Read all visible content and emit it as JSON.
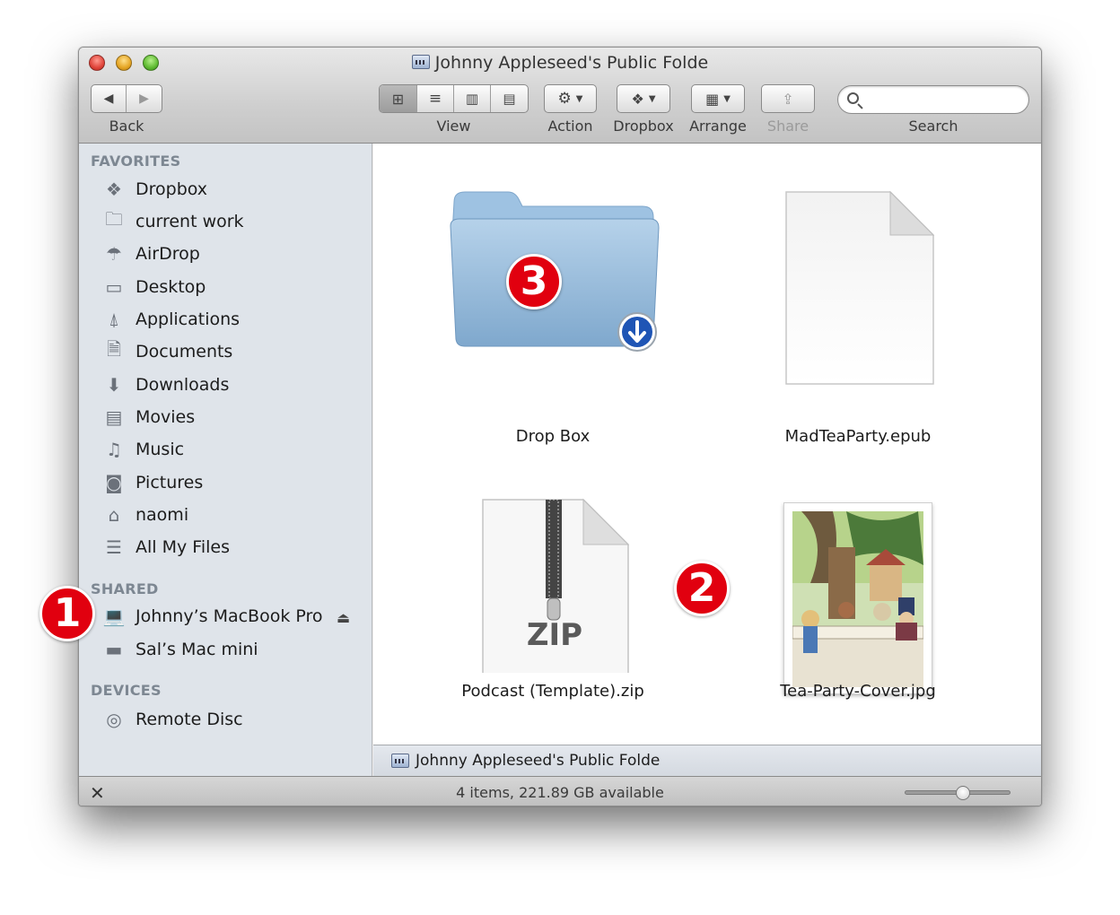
{
  "window": {
    "title": "Johnny Appleseed's Public Folde"
  },
  "toolbar": {
    "back_label": "Back",
    "view_label": "View",
    "action_label": "Action",
    "dropbox_label": "Dropbox",
    "arrange_label": "Arrange",
    "share_label": "Share",
    "search_label": "Search",
    "search_value": ""
  },
  "sidebar": {
    "favorites_header": "FAVORITES",
    "favorites": [
      {
        "label": "Dropbox",
        "icon": "dropbox-icon"
      },
      {
        "label": "current work",
        "icon": "folder-icon"
      },
      {
        "label": "AirDrop",
        "icon": "airdrop-icon"
      },
      {
        "label": "Desktop",
        "icon": "desktop-icon"
      },
      {
        "label": "Applications",
        "icon": "applications-icon"
      },
      {
        "label": "Documents",
        "icon": "documents-icon"
      },
      {
        "label": "Downloads",
        "icon": "downloads-icon"
      },
      {
        "label": "Movies",
        "icon": "movies-icon"
      },
      {
        "label": "Music",
        "icon": "music-icon"
      },
      {
        "label": "Pictures",
        "icon": "pictures-icon"
      },
      {
        "label": "naomi",
        "icon": "home-icon"
      },
      {
        "label": "All My Files",
        "icon": "all-files-icon"
      }
    ],
    "shared_header": "SHARED",
    "shared": [
      {
        "label": "Johnny’s MacBook Pro",
        "icon": "laptop-icon"
      },
      {
        "label": "Sal’s Mac mini",
        "icon": "mac-mini-icon"
      }
    ],
    "devices_header": "DEVICES",
    "devices": [
      {
        "label": "Remote Disc",
        "icon": "disc-icon"
      }
    ]
  },
  "files": [
    {
      "name": "Drop Box",
      "icon": "dropbox-folder-icon"
    },
    {
      "name": "MadTeaParty.epub",
      "icon": "document-icon"
    },
    {
      "name": "Podcast (Template).zip",
      "icon": "zip-icon",
      "badge_text": "ZIP"
    },
    {
      "name": "Tea-Party-Cover.jpg",
      "icon": "image-thumbnail-icon"
    }
  ],
  "pathbar": {
    "label": "Johnny Appleseed's Public Folde"
  },
  "statusbar": {
    "text": "4 items, 221.89 GB available",
    "zoom_fraction": 0.55
  },
  "callouts": {
    "one": "1",
    "two": "2",
    "three": "3"
  },
  "colors": {
    "callout_red": "#e1000f",
    "sidebar_bg": "#dfe4ea",
    "folder_blue": "#8fb6d8"
  }
}
